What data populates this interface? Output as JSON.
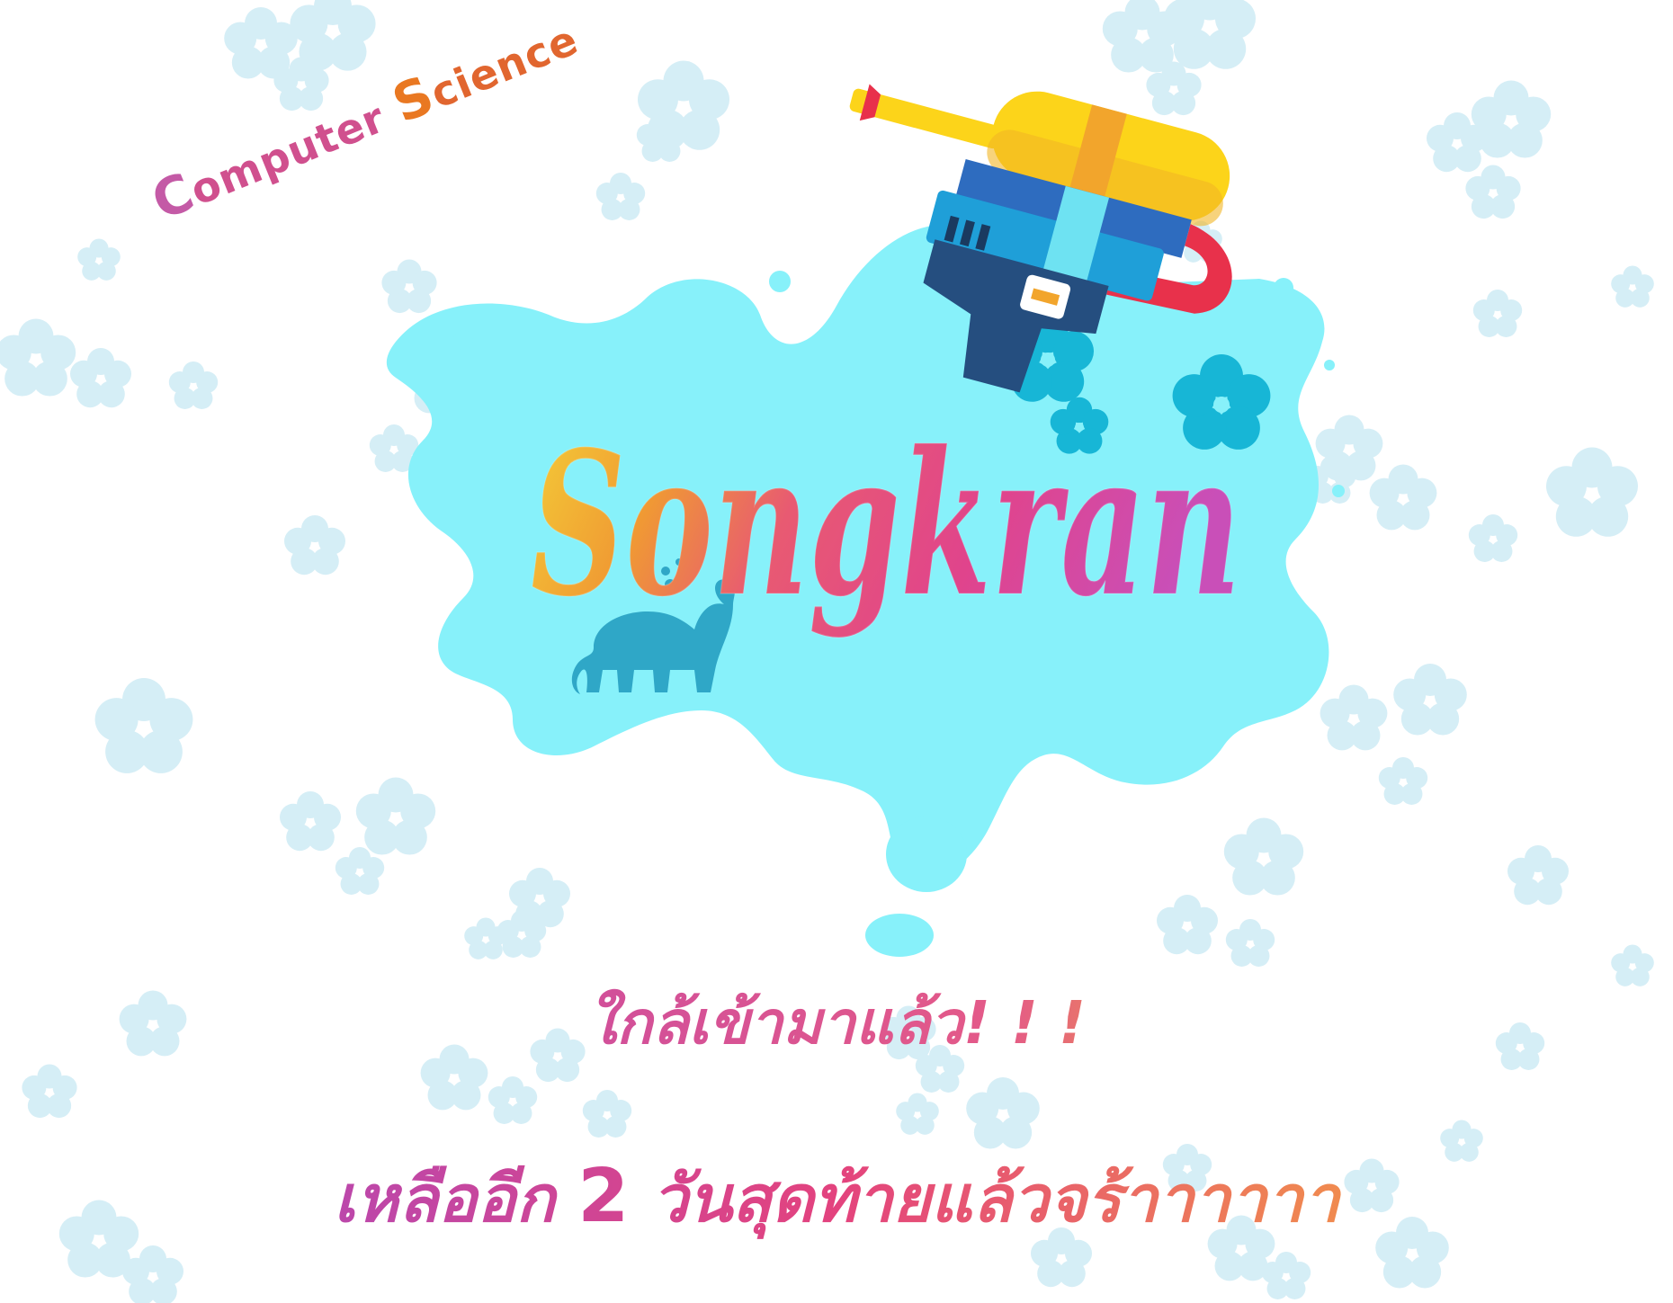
{
  "organizer": {
    "part1_initial": "C",
    "part1_rest": "omputer",
    "part2_initial": "S",
    "part2_rest": "cience"
  },
  "logo_text": "Songkran",
  "headline": "ใกล้เข้ามาแล้ว! ! !",
  "countdown": {
    "prefix": "เหลืออีก",
    "days": "2",
    "suffix": "วันสุดท้ายแล้วจร้าาาาาา"
  },
  "colors": {
    "splash": "#87f1fa",
    "flower_light": "#d3eef6",
    "flower_dark": "#17b6d6",
    "pink": "#e0468b",
    "orange": "#ef7c22",
    "yellow": "#f3c436",
    "gun_yellow": "#fcd41a",
    "gun_blue": "#1f9fd8",
    "gun_navy": "#254e7f",
    "gun_red": "#e8314b",
    "elephant": "#2fa7c7"
  },
  "icons": [
    "flower-icon",
    "water-gun-icon",
    "elephant-icon",
    "water-splash-icon"
  ]
}
